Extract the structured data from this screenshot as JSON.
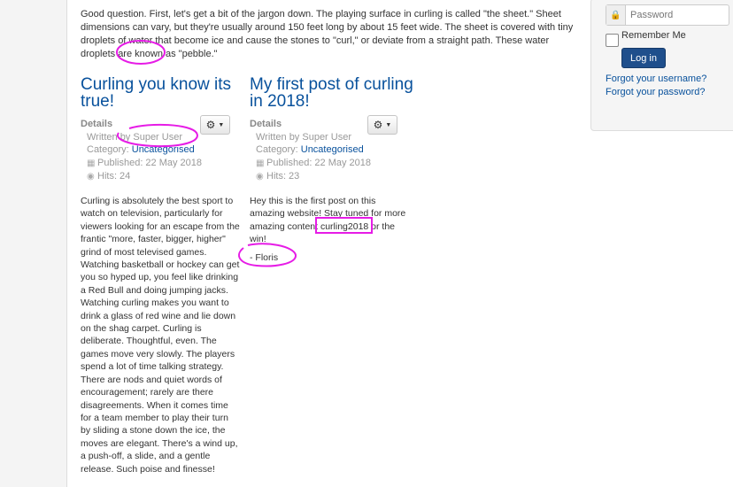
{
  "intro": {
    "text": "Good question. First, let's get a bit of the jargon down. The playing surface in curling is called \"the sheet.\" Sheet dimensions can vary, but they're usually around 150 feet long by about 15 feet wide. The sheet is covered with tiny droplets of water that become ice and cause the stones to \"curl,\" or deviate from a straight path. These water droplets are known as \"pebble.\""
  },
  "articles": [
    {
      "title": "Curling you know its true!",
      "details_label": "Details",
      "author": "Written by Super User",
      "category_prefix": "Category: ",
      "category": "Uncategorised",
      "published": "Published: 22 May 2018",
      "hits": "Hits: 24",
      "body": "Curling is absolutely the best sport to watch on television, particularly for viewers looking for an escape from the frantic \"more, faster, bigger, higher\" grind of most televised games. Watching basketball or hockey can get you so hyped up, you feel like drinking a Red Bull and doing jumping jacks. Watching curling makes you want to drink a glass of red wine and lie down on the shag carpet. Curling is deliberate. Thoughtful, even. The games move very slowly. The players spend a lot of time talking strategy. There are nods and quiet words of encouragement; rarely are there disagreements. When it comes time for a team member to play their turn by sliding a stone down the ice, the moves are elegant. There's a wind up, a push-off, a slide, and a gentle release. Such poise and finesse!"
    },
    {
      "title": "My first post of curling in 2018!",
      "details_label": "Details",
      "author": "Written by Super User",
      "category_prefix": "Category: ",
      "category": "Uncategorised",
      "published": "Published: 22 May 2018",
      "hits": "Hits: 23",
      "body": "Hey this is the first post on this amazing website! Stay tuned for more amazing content curling2018 or the win!",
      "signature": "- Floris"
    }
  ],
  "login": {
    "password_placeholder": "Password",
    "remember_label": "Remember Me",
    "login_button": "Log in",
    "forgot_username": "Forgot your username?",
    "forgot_password": "Forgot your password?"
  },
  "icons": {
    "gear": "gear-icon",
    "calendar": "calendar-icon",
    "eye": "eye-icon",
    "lock": "lock-icon"
  },
  "colors": {
    "link": "#08519c",
    "annotation": "#e61ce6",
    "button": "#1f4f8c"
  }
}
